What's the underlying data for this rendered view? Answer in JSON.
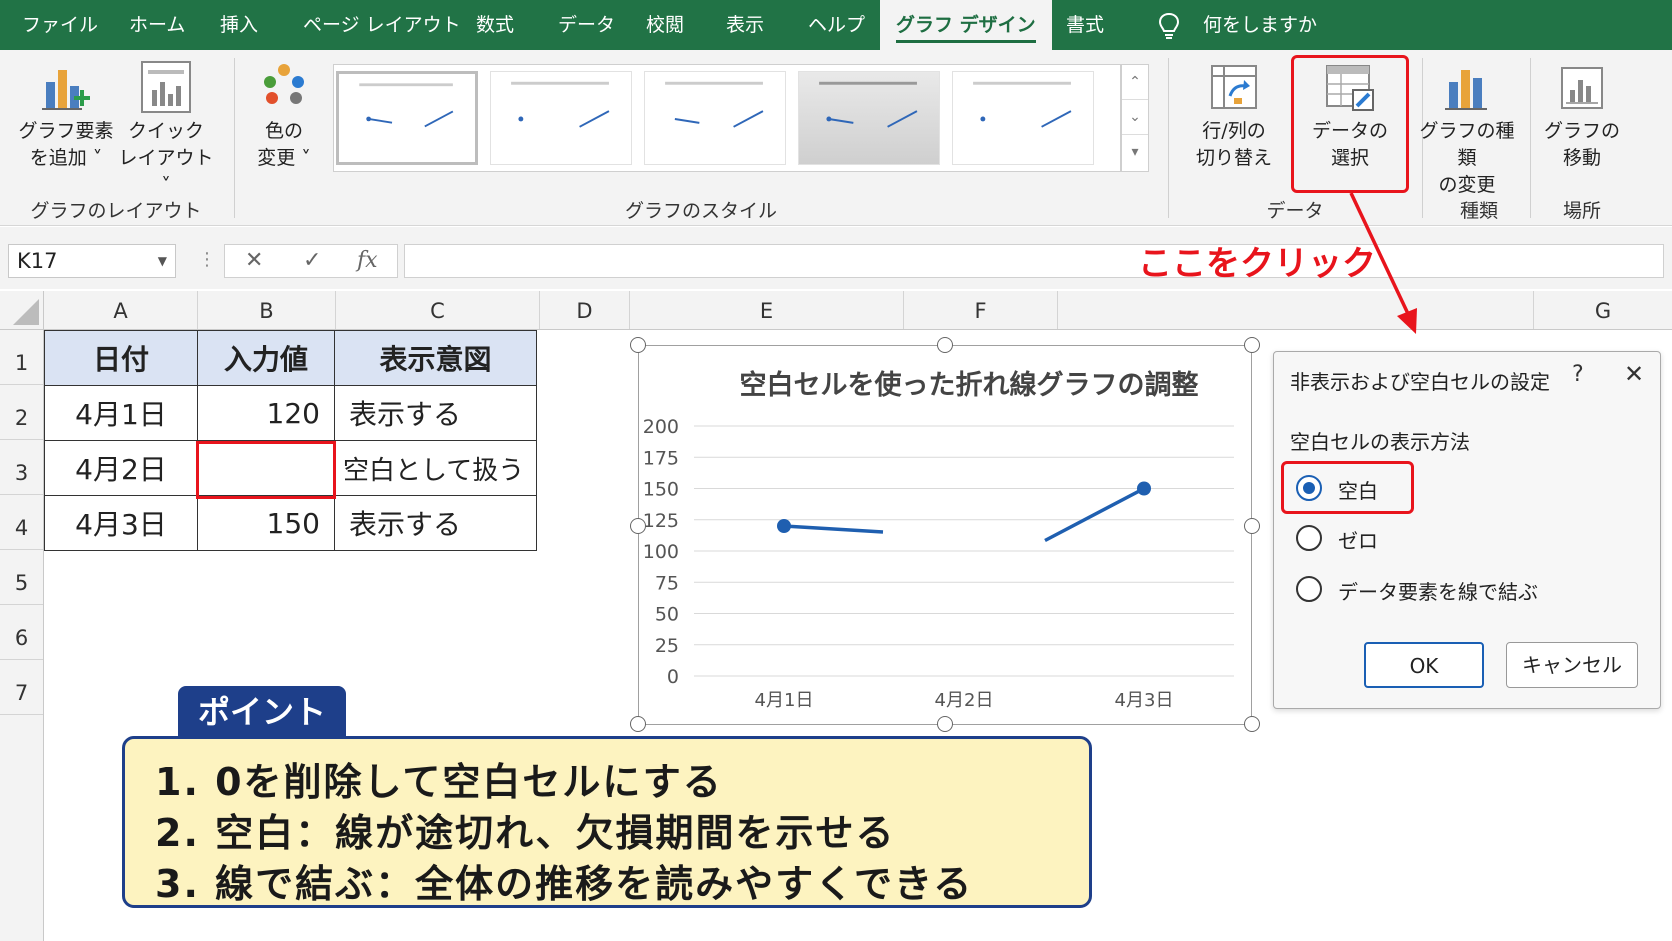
{
  "tabs": [
    "ファイル",
    "ホーム",
    "挿入",
    "ページ レイアウト",
    "数式",
    "データ",
    "校閲",
    "表示",
    "ヘルプ",
    "グラフ デザイン",
    "書式"
  ],
  "active_tab": "グラフ デザイン",
  "tell_me": "何をしますか",
  "ribbon": {
    "add_element": [
      "グラフ要素",
      "を追加 ˅"
    ],
    "quick_layout": [
      "クイック",
      "レイアウト ˅"
    ],
    "change_color": [
      "色の",
      "変更 ˅"
    ],
    "switch_row_col": [
      "行/列の",
      "切り替え"
    ],
    "select_data": [
      "データの",
      "選択"
    ],
    "change_type": [
      "グラフの種類",
      "の変更"
    ],
    "move_chart": [
      "グラフの",
      "移動"
    ],
    "groups": {
      "layout": "グラフのレイアウト",
      "styles": "グラフのスタイル",
      "data": "データ",
      "type": "種類",
      "location": "場所"
    }
  },
  "formula_bar": {
    "name_box": "K17",
    "cancel": "✕",
    "enter": "✓",
    "fx": "fx",
    "formula": ""
  },
  "columns": [
    "A",
    "B",
    "C",
    "D",
    "E",
    "F",
    "G"
  ],
  "rows": [
    "1",
    "2",
    "3",
    "4",
    "5",
    "6",
    "7"
  ],
  "table": {
    "headers": [
      "日付",
      "入力値",
      "表示意図"
    ],
    "rows": [
      [
        "4月1日",
        "120",
        "表示する"
      ],
      [
        "4月2日",
        "",
        "空白として扱う"
      ],
      [
        "4月3日",
        "150",
        "表示する"
      ]
    ]
  },
  "annotation": "ここをクリック",
  "chart_data": {
    "type": "line",
    "title": "空白セルを使った折れ線グラフの調整",
    "categories": [
      "4月1日",
      "4月2日",
      "4月3日"
    ],
    "series": [
      {
        "values": [
          120,
          null,
          150
        ]
      }
    ],
    "yticks": [
      "200",
      "175",
      "150",
      "125",
      "100",
      "75",
      "50",
      "25",
      "0"
    ],
    "ylim": [
      0,
      200
    ],
    "line_color": "#1f5fb0",
    "grid": true
  },
  "dialog": {
    "title": "非表示および空白セルの設定",
    "help": "?",
    "close": "✕",
    "section": "空白セルの表示方法",
    "options": [
      "空白",
      "ゼロ",
      "データ要素を線で結ぶ"
    ],
    "selected": "空白",
    "ok": "OK",
    "cancel": "キャンセル"
  },
  "point": {
    "title": "ポイント",
    "lines": [
      "1. 0を削除して空白セルにする",
      "2. 空白：線が途切れ、欠損期間を示せる",
      "3. 線で結ぶ：全体の推移を読みやすくできる"
    ]
  },
  "colors": {
    "excel_green": "#217346",
    "highlight_red": "#e8141c",
    "point_navy": "#1e3f8a",
    "point_bg": "#fdf3c0",
    "header_blue": "#dae3f3"
  }
}
